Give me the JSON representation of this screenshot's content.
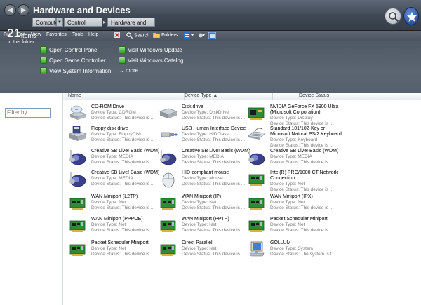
{
  "window": {
    "title": "Hardware and Devices",
    "address": [
      "Computer",
      "Control Panel",
      "Hardware and Devices"
    ]
  },
  "menu": [
    "File",
    "Edit",
    "View",
    "Favorites",
    "Tools",
    "Help"
  ],
  "toolbar": {
    "search": "Search",
    "folders": "Folders"
  },
  "summary": {
    "count": "21",
    "count_word": "items",
    "location": "in this folder"
  },
  "tasks": [
    "Open Control Panel",
    "Open Game Controller...",
    "View System Information",
    "Visit Windows Update",
    "Visit Windows Catalog",
    "more"
  ],
  "filter": {
    "placeholder": "Filter by"
  },
  "columns": {
    "name": "Name",
    "type": "Device Type",
    "status": "Device Status"
  },
  "items": [
    {
      "name": "CD-ROM Drive",
      "type": "Device Type: CDROM",
      "status": "Device Status: This device is ...",
      "icon": "cdrom-icon"
    },
    {
      "name": "Disk drive",
      "type": "Device Type: DiskDrive",
      "status": "Device Status: This device is ...",
      "icon": "disk-drive-icon"
    },
    {
      "name": "NVIDIA GeForce FX 5900 Ultra",
      "name2": "(Microsoft Corporation)",
      "type": "Device Type: Display",
      "status": "Device Status: This device is ...",
      "icon": "display-card-icon"
    },
    {
      "name": "Floppy disk drive",
      "type": "Device Type: FloppyDisk",
      "status": "Device Status: This device is ...",
      "icon": "floppy-drive-icon"
    },
    {
      "name": "USB Human Interface Device",
      "type": "Device Type: HIDClass",
      "status": "Device Status: This device is ...",
      "icon": "usb-icon"
    },
    {
      "name": "Standard 101/102-Key or",
      "name2": "Microsoft Natural PS/2 Keyboard",
      "type": "Device Type: Keyboard",
      "status": "Device Status: This device is ...",
      "icon": "keyboard-icon"
    },
    {
      "name": "Creative SB Live! Basic (WDM)",
      "type": "Device Type: MEDIA",
      "status": "Device Status: This device is ...",
      "icon": "speaker-icon"
    },
    {
      "name": "Creative SB Live! Basic (WDM)",
      "type": "Device Type: MEDIA",
      "status": "Device Status: This device is ...",
      "icon": "speaker-icon"
    },
    {
      "name": "Creative SB Live! Basic (WDM)",
      "type": "Device Type: MEDIA",
      "status": "Device Status: This device is ...",
      "icon": "speaker-icon"
    },
    {
      "name": "Creative SB Live! Basic (WDM)",
      "type": "Device Type: MEDIA",
      "status": "Device Status: This device is ...",
      "icon": "speaker-icon"
    },
    {
      "name": "HID-compliant mouse",
      "type": "Device Type: Mouse",
      "status": "Device Status: This device is ...",
      "icon": "mouse-icon"
    },
    {
      "name": "Intel(R) PRO/1000 CT Network",
      "name2": "Connection",
      "type": "Device Type: Net",
      "status": "Device Status: This device is ...",
      "icon": "network-card-icon"
    },
    {
      "name": "WAN Miniport (L2TP)",
      "type": "Device Type: Net",
      "status": "Device Status: This device is ...",
      "icon": "network-card-icon"
    },
    {
      "name": "WAN Miniport (IP)",
      "type": "Device Type: Net",
      "status": "Device Status: This device is ...",
      "icon": "network-card-icon"
    },
    {
      "name": "WAN Miniport (IPX)",
      "type": "Device Type: Net",
      "status": "Device Status: This device is ...",
      "icon": "network-card-icon"
    },
    {
      "name": "WAN Miniport (PPPOE)",
      "type": "Device Type: Net",
      "status": "Device Status: This device is ...",
      "icon": "network-card-icon"
    },
    {
      "name": "WAN Miniport (PPTP)",
      "type": "Device Type: Net",
      "status": "Device Status: This device is ...",
      "icon": "network-card-icon"
    },
    {
      "name": "Packet Scheduler Miniport",
      "type": "Device Type: Net",
      "status": "Device Status: This device is ...",
      "icon": "network-card-icon"
    },
    {
      "name": "Packet Scheduler Miniport",
      "type": "Device Type: Net",
      "status": "Device Status: This device is ...",
      "icon": "network-card-icon"
    },
    {
      "name": "Direct Parallel",
      "type": "Device Type: Net",
      "status": "Device Status: This device is ...",
      "icon": "network-card-icon"
    },
    {
      "name": "GOLLUM",
      "type": "Device Type: System",
      "status": "Device Status: The system is f...",
      "icon": "computer-icon"
    }
  ]
}
